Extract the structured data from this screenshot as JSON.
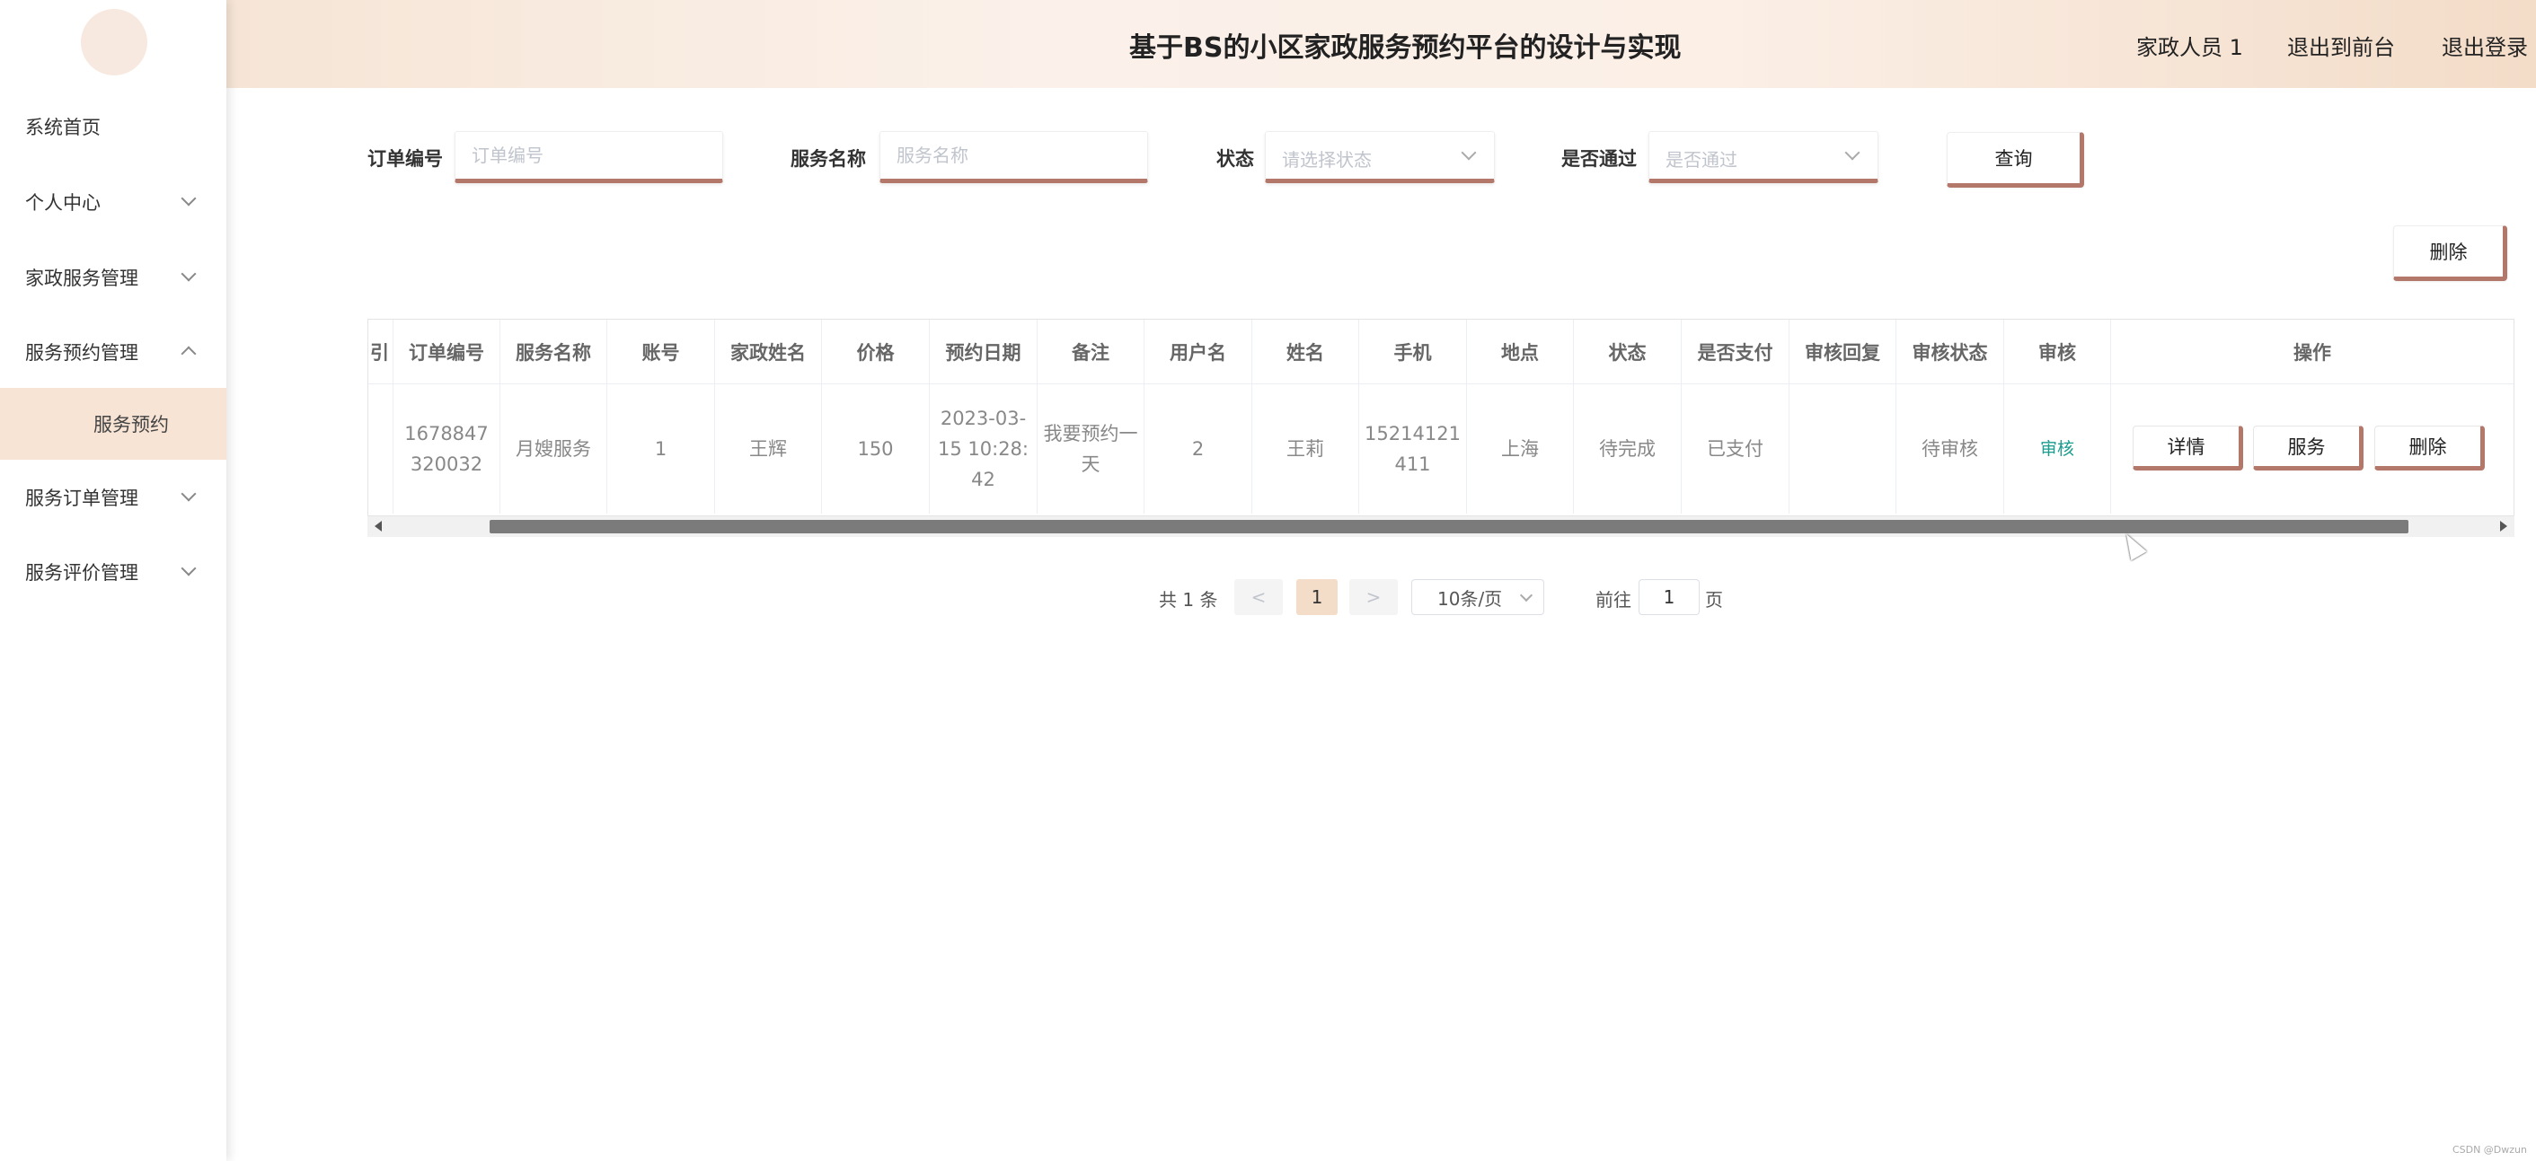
{
  "header": {
    "title": "基于BS的小区家政服务预约平台的设计与实现",
    "user": "家政人员 1",
    "to_front": "退出到前台",
    "logout": "退出登录"
  },
  "sidebar": {
    "items": [
      {
        "label": "系统首页"
      },
      {
        "label": "个人中心"
      },
      {
        "label": "家政服务管理"
      },
      {
        "label": "服务预约管理"
      },
      {
        "label": "服务预约"
      },
      {
        "label": "服务订单管理"
      },
      {
        "label": "服务评价管理"
      }
    ]
  },
  "search": {
    "order_no_label": "订单编号",
    "order_no_placeholder": "订单编号",
    "service_name_label": "服务名称",
    "service_name_placeholder": "服务名称",
    "status_label": "状态",
    "status_placeholder": "请选择状态",
    "passed_label": "是否通过",
    "passed_placeholder": "是否通过",
    "query_button": "查询",
    "delete_button": "删除"
  },
  "table": {
    "partial_col": "引",
    "headers": [
      "订单编号",
      "服务名称",
      "账号",
      "家政姓名",
      "价格",
      "预约日期",
      "备注",
      "用户名",
      "姓名",
      "手机",
      "地点",
      "状态",
      "是否支付",
      "审核回复",
      "审核状态",
      "审核",
      "操作"
    ],
    "row": {
      "order_no": "1678847320032",
      "service_name": "月嫂服务",
      "account": "1",
      "worker_name": "王辉",
      "price": "150",
      "date": "2023-03-15 10:28:42",
      "remark": "我要预约一天",
      "username": "2",
      "name": "王莉",
      "phone": "15214121411",
      "location": "上海",
      "status": "待完成",
      "paid": "已支付",
      "audit_reply": "",
      "audit_status": "待审核",
      "audit_link": "审核",
      "actions": [
        "详情",
        "服务",
        "删除"
      ]
    }
  },
  "pagination": {
    "total": "共 1 条",
    "prev": "<",
    "current": "1",
    "next": ">",
    "page_size": "10条/页",
    "goto_prefix": "前往",
    "goto_value": "1",
    "goto_suffix": "页"
  },
  "watermark": "CSDN @Dwzun"
}
